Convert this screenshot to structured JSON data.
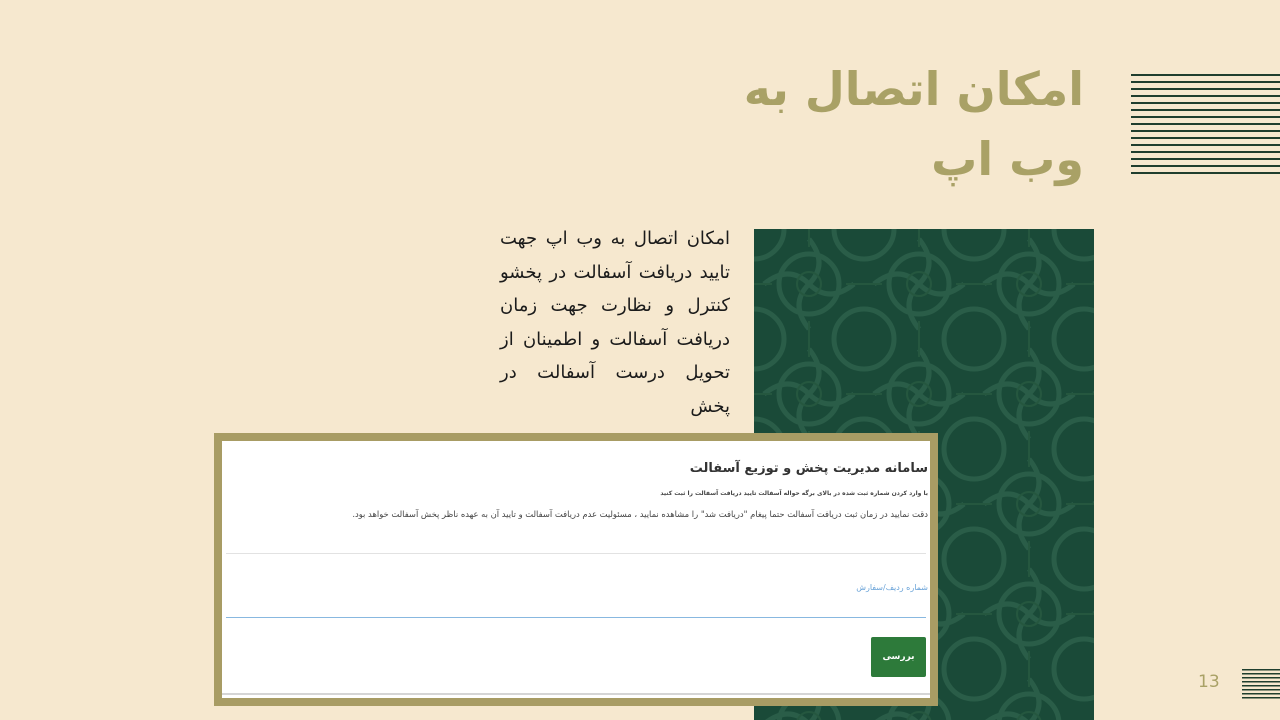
{
  "slide": {
    "title": "امکان اتصال به وب اپ",
    "body": "امکان اتصال به وب اپ جهت تایید دریافت آسفالت در پخشو کنترل و نظارت جهت زمان دریافت آسفالت و اطمینان از تحویل درست آسفالت در پخش",
    "page_number": "13"
  },
  "webapp": {
    "title": "سامانه مدیریت پخش و توزیع آسفالت",
    "hint": "با وارد کردن شماره ثبت شده در بالای برگه حواله آسفالت تایید دریافت آسفالت را ثبت کنید",
    "warning": "دقت نمایید در زمان ثبت دریافت آسفالت حتما پیغام \"دریافت شد\" را مشاهده نمایید ، مسئولیت عدم دریافت آسفالت و تایید آن به عهده ناظر پخش آسفالت خواهد بود.",
    "field_label": "شماره ردیف/سفارش",
    "field_value": "",
    "submit_label": "بررسی"
  },
  "colors": {
    "background": "#f6e8cf",
    "accent": "#a9a166",
    "pattern_green": "#1a4a38",
    "button_green": "#2d7a3a",
    "field_blue": "#6aa3d8"
  }
}
